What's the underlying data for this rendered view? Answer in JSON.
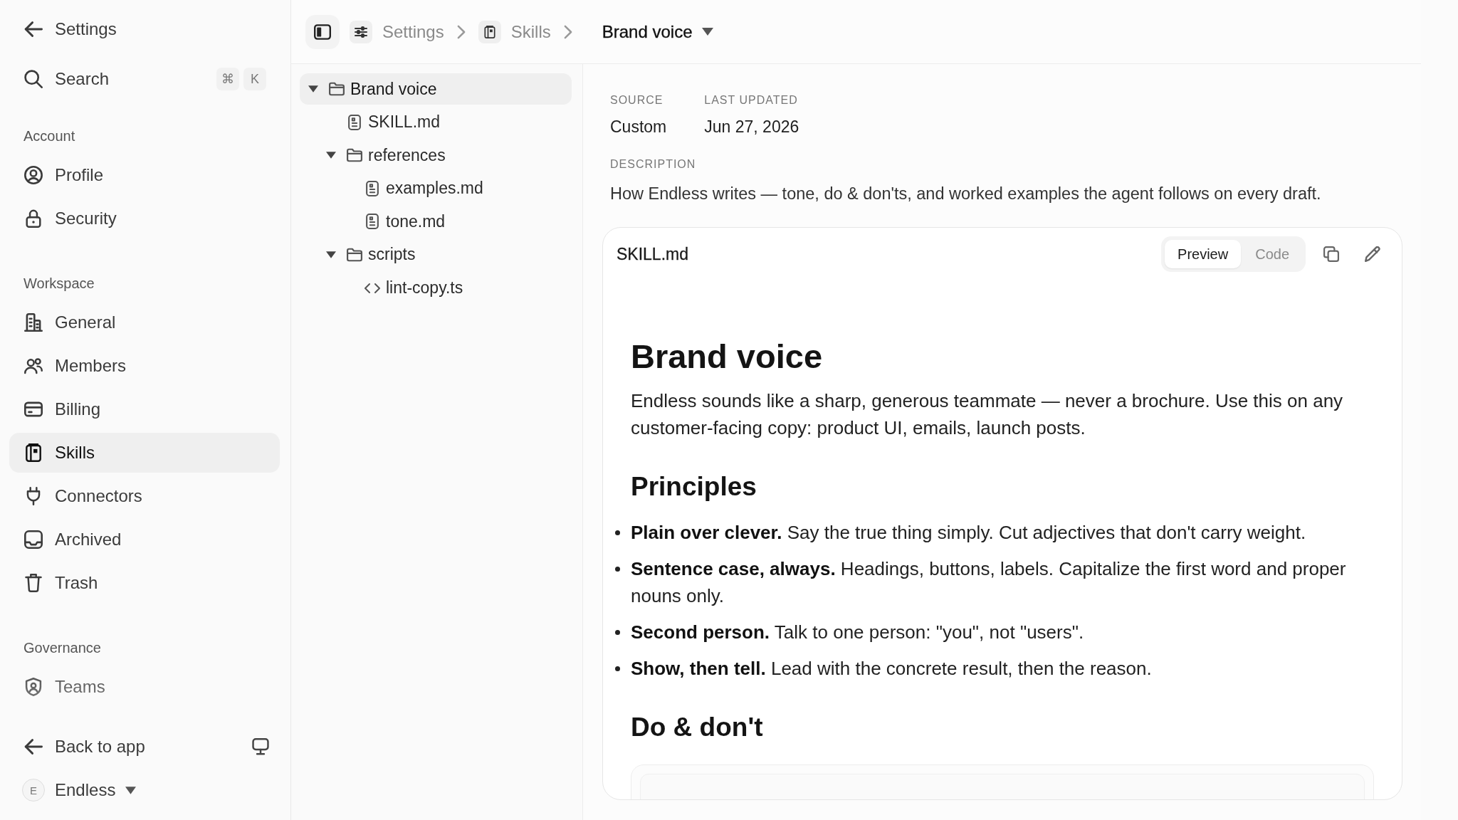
{
  "sidebar": {
    "back": {
      "label": "Settings"
    },
    "search": {
      "label": "Search",
      "shortcut": [
        "⌘",
        "K"
      ]
    },
    "sections": [
      {
        "title": "Account",
        "items": [
          {
            "label": "Profile",
            "selected": false
          },
          {
            "label": "Security",
            "selected": false
          }
        ]
      },
      {
        "title": "Workspace",
        "items": [
          {
            "label": "General",
            "selected": false
          },
          {
            "label": "Members",
            "selected": false
          },
          {
            "label": "Billing",
            "selected": false
          },
          {
            "label": "Skills",
            "selected": true
          },
          {
            "label": "Connectors",
            "selected": false
          },
          {
            "label": "Archived",
            "selected": false
          },
          {
            "label": "Trash",
            "selected": false
          }
        ]
      },
      {
        "title": "Governance",
        "items": [
          {
            "label": "Teams",
            "selected": false
          }
        ]
      }
    ],
    "footer": {
      "back_link": {
        "label": "Back to app"
      },
      "workspace": {
        "initial": "E",
        "name": "Endless"
      }
    }
  },
  "breadcrumb": [
    {
      "label": "Settings",
      "current": false
    },
    {
      "label": "Skills",
      "current": false
    },
    {
      "label": "Brand voice",
      "current": true
    }
  ],
  "tree": [
    {
      "kind": "folder",
      "name": "Brand voice",
      "expanded": true,
      "selected": true,
      "children": [
        {
          "kind": "markdown",
          "name": "SKILL.md",
          "selected": false
        },
        {
          "kind": "folder",
          "name": "references",
          "expanded": true,
          "selected": false,
          "children": [
            {
              "kind": "markdown",
              "name": "examples.md",
              "selected": false
            },
            {
              "kind": "markdown",
              "name": "tone.md",
              "selected": false
            }
          ]
        },
        {
          "kind": "folder",
          "name": "scripts",
          "expanded": true,
          "selected": false,
          "children": [
            {
              "kind": "script",
              "name": "lint-copy.ts",
              "selected": false
            }
          ]
        }
      ]
    }
  ],
  "details": {
    "meta": [
      {
        "label": "SOURCE",
        "value": "Custom"
      },
      {
        "label": "LAST UPDATED",
        "value": "Jun 27, 2026"
      }
    ],
    "description": {
      "label": "DESCRIPTION",
      "text": "How Endless writes — tone, do & don'ts, and worked examples the agent follows on every draft."
    }
  },
  "file_card": {
    "title": "SKILL.md",
    "view_tabs": [
      {
        "label": "Preview",
        "selected": true
      },
      {
        "label": "Code",
        "selected": false
      }
    ],
    "document": [
      {
        "kind": "h1",
        "text": "Brand voice"
      },
      {
        "kind": "paragraph",
        "text": "Endless sounds like a sharp, generous teammate — never a brochure. Use this on any customer-facing copy: product UI, emails, launch posts."
      },
      {
        "kind": "h2",
        "text": "Principles"
      },
      {
        "kind": "list",
        "items": [
          "**Plain over clever.** Say the true thing simply. Cut adjectives that don't carry weight.",
          "**Sentence case, always.** Headings, buttons, labels. Capitalize the first word and proper nouns only.",
          "**Second person.** Talk to one person: \"you\", not \"users\".",
          "**Show, then tell.** Lead with the concrete result, then the reason."
        ]
      },
      {
        "kind": "h2",
        "text": "Do & don't"
      },
      {
        "kind": "table"
      }
    ]
  }
}
